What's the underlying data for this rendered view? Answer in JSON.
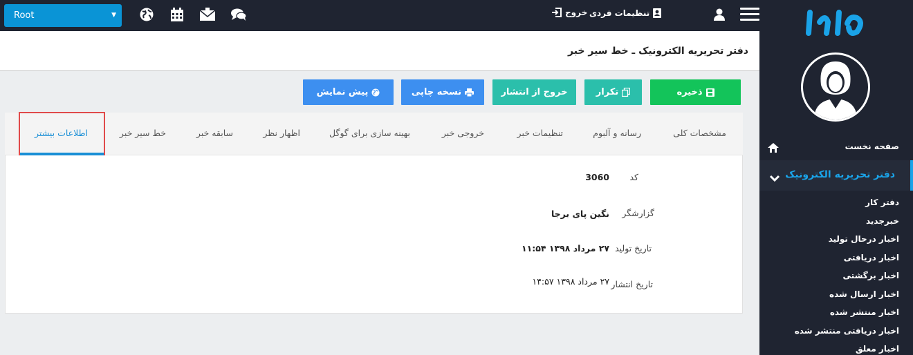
{
  "topbar": {
    "root_select_value": "Root",
    "settings_label": "تنظیمات فردی",
    "logout_label": "خروج",
    "icons": [
      "globe-icon",
      "calendar-icon",
      "envelope-icon",
      "chat-icon",
      "user-icon",
      "hamburger-icon"
    ]
  },
  "sidebar": {
    "home_label": "صفحه نخست",
    "active_section": "دفتر تحریریه الکترونیک",
    "items": [
      {
        "label": "دفتر کار"
      },
      {
        "label": "خبرجدید"
      },
      {
        "label": "اخبار درحال تولید"
      },
      {
        "label": "اخبار دریافتی"
      },
      {
        "label": "اخبار برگشتی"
      },
      {
        "label": "اخبار ارسال شده"
      },
      {
        "label": "اخبار منتشر شده"
      },
      {
        "label": "اخبار دریافتی منتشر شده"
      },
      {
        "label": "اخبار معلق"
      }
    ]
  },
  "header": {
    "title": "دفتر تحریریه الکترونیک ـ خط سیر خبر"
  },
  "actions": {
    "save": "ذخیره",
    "duplicate": "تکرار",
    "unpublish": "خروج از انتشار",
    "print": "نسخه چاپی",
    "preview": "پیش نمایش"
  },
  "tabs": [
    {
      "label": "مشخصات کلی"
    },
    {
      "label": "رسانه و آلبوم"
    },
    {
      "label": "تنظیمات خبر"
    },
    {
      "label": "خروجی خبر"
    },
    {
      "label": "بهینه سازی برای گوگل"
    },
    {
      "label": "اظهار نظر"
    },
    {
      "label": "سابقه خبر"
    },
    {
      "label": "خط سیر خبر"
    },
    {
      "label": "اطلاعات بیشتر"
    }
  ],
  "active_tab": "اطلاعات بیشتر",
  "fields": {
    "code_label": "کد",
    "code_value": "3060",
    "reporter_label": "گزارشگر",
    "reporter_value": "نگین پای برجا",
    "created_label": "تاریخ تولید",
    "created_value": "۲۷ مرداد ۱۳۹۸ ۱۱:۵۴",
    "published_label": "تاریخ انتشار",
    "published_value": "۲۷ مرداد ۱۳۹۸ ۱۴:۵۷"
  },
  "colors": {
    "dark_bg": "#1f2431",
    "accent_blue": "#1a8fd6",
    "save_green": "#13c45a",
    "teal": "#2bbfab",
    "button_blue": "#3d8ff0",
    "highlight_red": "#e04a4a"
  }
}
